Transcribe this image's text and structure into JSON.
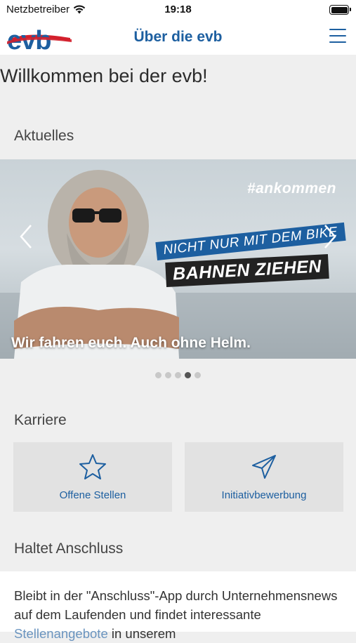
{
  "status_bar": {
    "carrier": "Netzbetreiber",
    "time": "19:18"
  },
  "nav": {
    "title": "Über die evb",
    "logo_text": "evb"
  },
  "welcome": "Willkommen bei der evb!",
  "news": {
    "heading": "Aktuelles",
    "slide": {
      "caption": "Wir fahren euch. Auch ohne Helm.",
      "hashtag": "#ankommen",
      "banner_top": "NICHT NUR MIT DEM BIKE",
      "banner_bottom": "BAHNEN ZIEHEN"
    },
    "dots_total": 5,
    "dots_active_index": 3
  },
  "career": {
    "heading": "Karriere",
    "cards": [
      {
        "label": "Offene Stellen",
        "icon": "star-icon"
      },
      {
        "label": "Initiativbewerbung",
        "icon": "paper-plane-icon"
      }
    ]
  },
  "anschluss": {
    "heading": "Haltet Anschluss",
    "text_before": "Bleibt in der \"Anschluss\"-App durch Unternehmensnews auf dem Laufenden und findet interessante ",
    "link": "Stellenangebote",
    "text_after": " in unserem"
  },
  "colors": {
    "brand_blue": "#1d5fa0",
    "brand_red": "#d3202c",
    "background": "#efefef"
  }
}
